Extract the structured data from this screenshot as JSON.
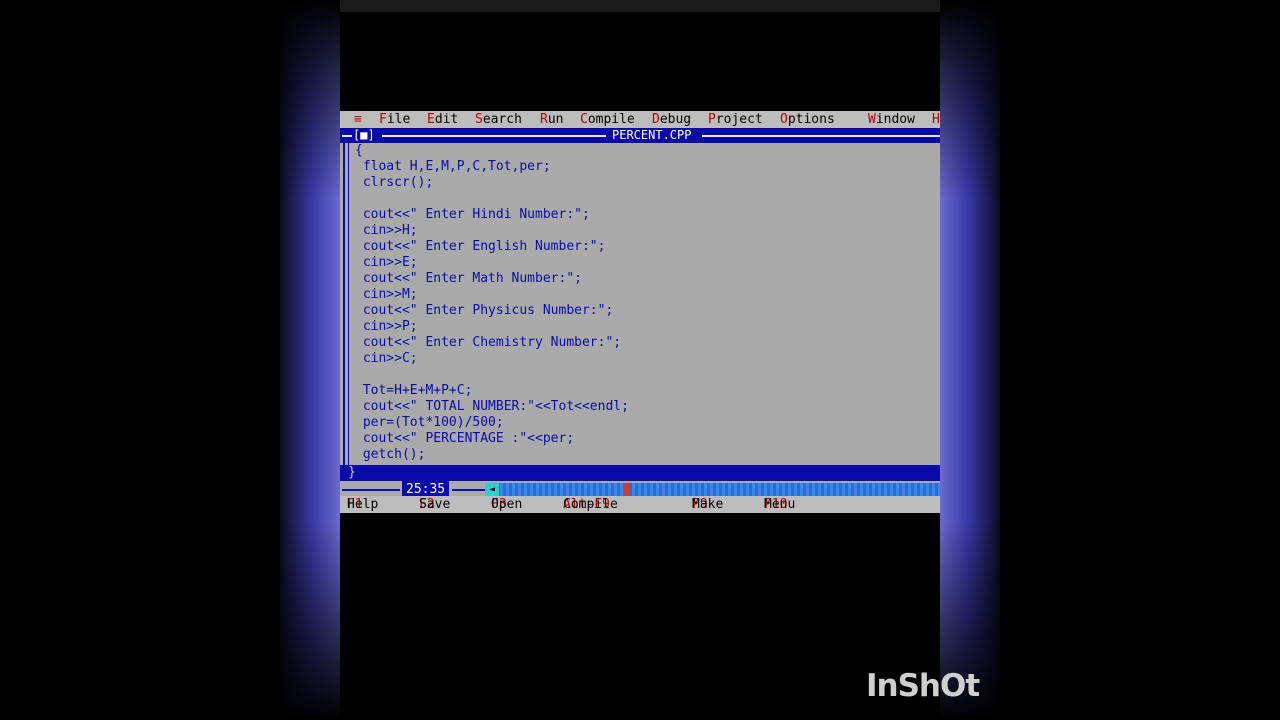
{
  "menu": {
    "system_icon": "≡",
    "items": [
      {
        "hot": "F",
        "rest": "ile"
      },
      {
        "hot": "E",
        "rest": "dit"
      },
      {
        "hot": "S",
        "rest": "earch"
      },
      {
        "hot": "R",
        "rest": "un"
      },
      {
        "hot": "C",
        "rest": "ompile"
      },
      {
        "hot": "D",
        "rest": "ebug"
      },
      {
        "hot": "P",
        "rest": "roject"
      },
      {
        "hot": "O",
        "rest": "ptions"
      },
      {
        "hot": "W",
        "rest": "indow"
      },
      {
        "hot": "H",
        "rest": ""
      }
    ]
  },
  "window": {
    "close_box": "[■]",
    "title": "PERCENT.CPP"
  },
  "editor": {
    "code_lines": [
      "{",
      " float H,E,M,P,C,Tot,per;",
      " clrscr();",
      "",
      " cout<<\" Enter Hindi Number:\";",
      " cin>>H;",
      " cout<<\" Enter English Number:\";",
      " cin>>E;",
      " cout<<\" Enter Math Number:\";",
      " cin>>M;",
      " cout<<\" Enter Physicus Number:\";",
      " cin>>P;",
      " cout<<\" Enter Chemistry Number:\";",
      " cin>>C;",
      "",
      " Tot=H+E+M+P+C;",
      " cout<<\" TOTAL NUMBER:\"<<Tot<<endl;",
      " per=(Tot*100)/500;",
      " cout<<\" PERCENTAGE :\"<<per;",
      " getch();"
    ],
    "current_line": "}",
    "cursor_position": "25:35"
  },
  "function_keys": [
    {
      "key": "F1",
      "label": "Help"
    },
    {
      "key": "F2",
      "label": "Save"
    },
    {
      "key": "F3",
      "label": "Open"
    },
    {
      "key": "Alt-F9",
      "label": "Compile"
    },
    {
      "key": "F9",
      "label": "Make"
    },
    {
      "key": "F10",
      "label": "Menu"
    }
  ],
  "watermark": "InShOt",
  "colors": {
    "editor_bg": "#aaaaaa",
    "code_text": "#0a0aa8",
    "menu_hotkey": "#c00000",
    "title_bar": "#0a0aa8"
  }
}
